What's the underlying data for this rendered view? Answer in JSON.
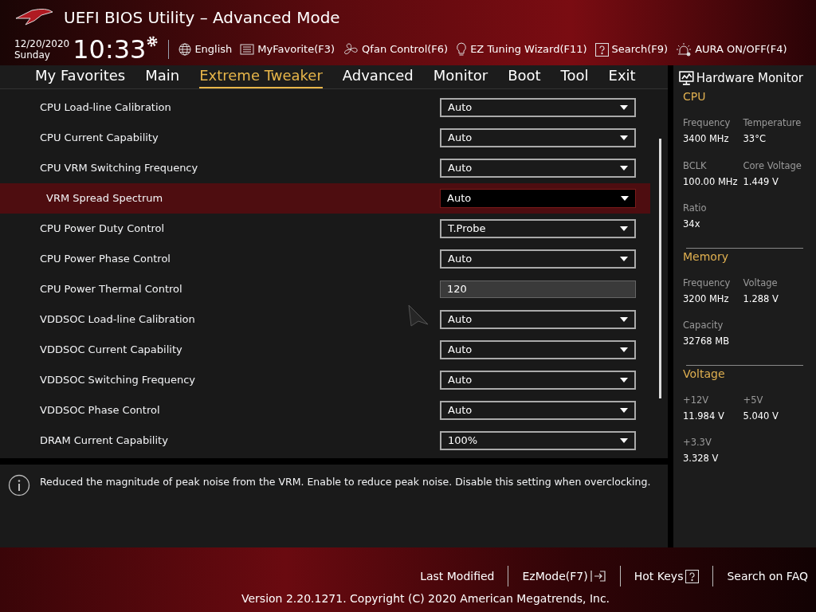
{
  "window": {
    "title": "UEFI BIOS Utility – Advanced Mode"
  },
  "clock": {
    "date": "12/20/2020",
    "day": "Sunday",
    "time": "10:33"
  },
  "toolbar": [
    {
      "kind": "globe",
      "label": "English"
    },
    {
      "kind": "list",
      "label": "MyFavorite(F3)"
    },
    {
      "kind": "fan",
      "label": "Qfan Control(F6)"
    },
    {
      "kind": "bulb",
      "label": "EZ Tuning Wizard(F11)"
    },
    {
      "kind": "help",
      "label": "Search(F9)"
    },
    {
      "kind": "aura",
      "label": "AURA ON/OFF(F4)"
    }
  ],
  "tabs": [
    {
      "label": "My Favorites",
      "selected": false
    },
    {
      "label": "Main",
      "selected": false
    },
    {
      "label": "Extreme Tweaker",
      "selected": true
    },
    {
      "label": "Advanced",
      "selected": false
    },
    {
      "label": "Monitor",
      "selected": false
    },
    {
      "label": "Boot",
      "selected": false
    },
    {
      "label": "Tool",
      "selected": false
    },
    {
      "label": "Exit",
      "selected": false
    }
  ],
  "settings": [
    {
      "label": "CPU Load-line Calibration",
      "kind": "dropdown",
      "value": "Auto",
      "selected": false
    },
    {
      "label": "CPU Current Capability",
      "kind": "dropdown",
      "value": "Auto",
      "selected": false
    },
    {
      "label": "CPU VRM Switching Frequency",
      "kind": "dropdown",
      "value": "Auto",
      "selected": false
    },
    {
      "label": "VRM Spread Spectrum",
      "kind": "dropdown",
      "value": "Auto",
      "selected": true
    },
    {
      "label": "CPU Power Duty Control",
      "kind": "dropdown",
      "value": "T.Probe",
      "selected": false
    },
    {
      "label": "CPU Power Phase Control",
      "kind": "dropdown",
      "value": "Auto",
      "selected": false
    },
    {
      "label": "CPU Power Thermal Control",
      "kind": "number",
      "value": "120",
      "selected": false
    },
    {
      "label": "VDDSOC Load-line Calibration",
      "kind": "dropdown",
      "value": "Auto",
      "selected": false
    },
    {
      "label": "VDDSOC Current Capability",
      "kind": "dropdown",
      "value": "Auto",
      "selected": false
    },
    {
      "label": "VDDSOC Switching Frequency",
      "kind": "dropdown",
      "value": "Auto",
      "selected": false
    },
    {
      "label": "VDDSOC Phase Control",
      "kind": "dropdown",
      "value": "Auto",
      "selected": false
    },
    {
      "label": "DRAM Current Capability",
      "kind": "dropdown",
      "value": "100%",
      "selected": false
    }
  ],
  "help_text": "Reduced the magnitude of peak noise from the VRM. Enable to reduce peak noise. Disable this setting when overclocking.",
  "hardware_monitor": {
    "title": "Hardware Monitor",
    "sections": [
      {
        "title": "CPU",
        "readings": [
          {
            "label": "Frequency",
            "value": "3400 MHz"
          },
          {
            "label": "Temperature",
            "value": "33°C"
          },
          {
            "label": "BCLK",
            "value": "100.00 MHz"
          },
          {
            "label": "Core Voltage",
            "value": "1.449 V"
          },
          {
            "label": "Ratio",
            "value": "34x"
          }
        ]
      },
      {
        "title": "Memory",
        "readings": [
          {
            "label": "Frequency",
            "value": "3200 MHz"
          },
          {
            "label": "Voltage",
            "value": "1.288 V"
          },
          {
            "label": "Capacity",
            "value": "32768 MB"
          }
        ]
      },
      {
        "title": "Voltage",
        "readings": [
          {
            "label": "+12V",
            "value": "11.984 V"
          },
          {
            "label": "+5V",
            "value": "5.040 V"
          },
          {
            "label": "+3.3V",
            "value": "3.328 V"
          }
        ]
      }
    ]
  },
  "footer": {
    "links": [
      {
        "kind": "plain",
        "label": "Last Modified"
      },
      {
        "kind": "exit",
        "label": "EzMode(F7)"
      },
      {
        "kind": "help",
        "label": "Hot Keys"
      },
      {
        "kind": "plain",
        "label": "Search on FAQ"
      }
    ],
    "copyright": "Version 2.20.1271. Copyright (C) 2020 American Megatrends, Inc."
  }
}
